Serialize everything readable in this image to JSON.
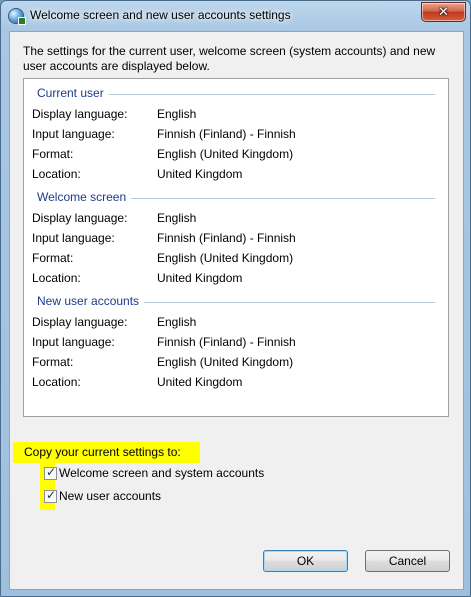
{
  "window": {
    "title": "Welcome screen and new user accounts settings",
    "close_symbol": "✕"
  },
  "description": "The settings for the current user, welcome screen (system accounts) and new user accounts are displayed below.",
  "sections": [
    {
      "title": "Current user",
      "rows": [
        {
          "label": "Display language:",
          "value": "English"
        },
        {
          "label": "Input language:",
          "value": "Finnish (Finland) - Finnish"
        },
        {
          "label": "Format:",
          "value": "English (United Kingdom)"
        },
        {
          "label": "Location:",
          "value": "United Kingdom"
        }
      ]
    },
    {
      "title": "Welcome screen",
      "rows": [
        {
          "label": "Display language:",
          "value": "English"
        },
        {
          "label": "Input language:",
          "value": "Finnish (Finland) - Finnish"
        },
        {
          "label": "Format:",
          "value": "English (United Kingdom)"
        },
        {
          "label": "Location:",
          "value": "United Kingdom"
        }
      ]
    },
    {
      "title": "New user accounts",
      "rows": [
        {
          "label": "Display language:",
          "value": "English"
        },
        {
          "label": "Input language:",
          "value": "Finnish (Finland) - Finnish"
        },
        {
          "label": "Format:",
          "value": "English (United Kingdom)"
        },
        {
          "label": "Location:",
          "value": "United Kingdom"
        }
      ]
    }
  ],
  "copy": {
    "label": "Copy your current settings to:",
    "options": [
      {
        "label": "Welcome screen and system accounts",
        "checked": true
      },
      {
        "label": "New user accounts",
        "checked": true
      }
    ]
  },
  "buttons": {
    "ok": "OK",
    "cancel": "Cancel"
  },
  "colors": {
    "highlight": "#ffff00",
    "section_title": "#1e3a8a"
  }
}
